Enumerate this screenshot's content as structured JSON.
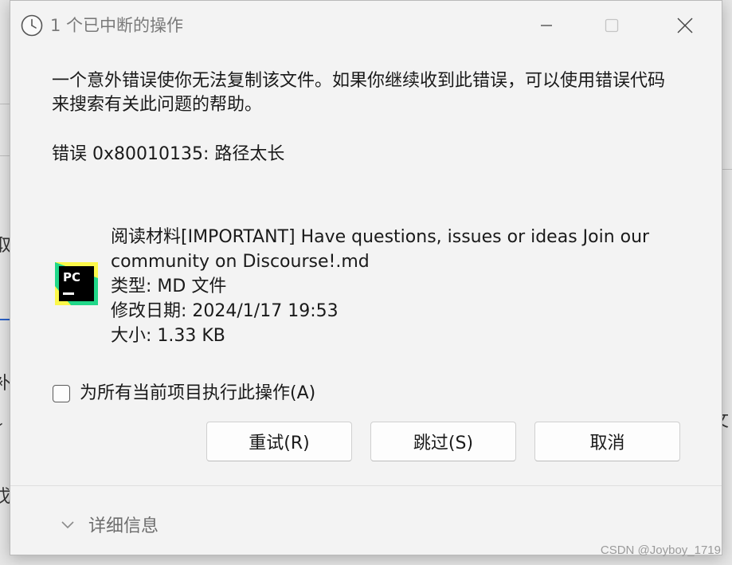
{
  "window": {
    "title": "1 个已中断的操作"
  },
  "message": {
    "text": "一个意外错误使你无法复制该文件。如果你继续收到此错误，可以使用错误代码来搜索有关此问题的帮助。",
    "error": "错误 0x80010135: 路径太长"
  },
  "file": {
    "icon_text": "PC",
    "name": "阅读材料[IMPORTANT] Have questions, issues or ideas Join our community on Discourse!.md",
    "type": "类型: MD 文件",
    "modified": "修改日期: 2024/1/17 19:53",
    "size": "大小: 1.33 KB"
  },
  "option": {
    "apply_all_label": "为所有当前项目执行此操作(A)"
  },
  "buttons": {
    "retry": "重试(R)",
    "skip": "跳过(S)",
    "cancel": "取消"
  },
  "footer": {
    "details_label": "详细信息"
  },
  "background": {
    "frag_1": "取",
    "frag_2": "补",
    "frag_3": "讠",
    "frag_4": "戊",
    "frag_5": "文("
  },
  "watermark": "CSDN @Joyboy_1719",
  "colors": {
    "dialog_bg": "#f3f3f3",
    "button_bg": "#fdfdfd",
    "pycharm_green": "#21d789",
    "pycharm_yellow": "#fcf84a"
  }
}
